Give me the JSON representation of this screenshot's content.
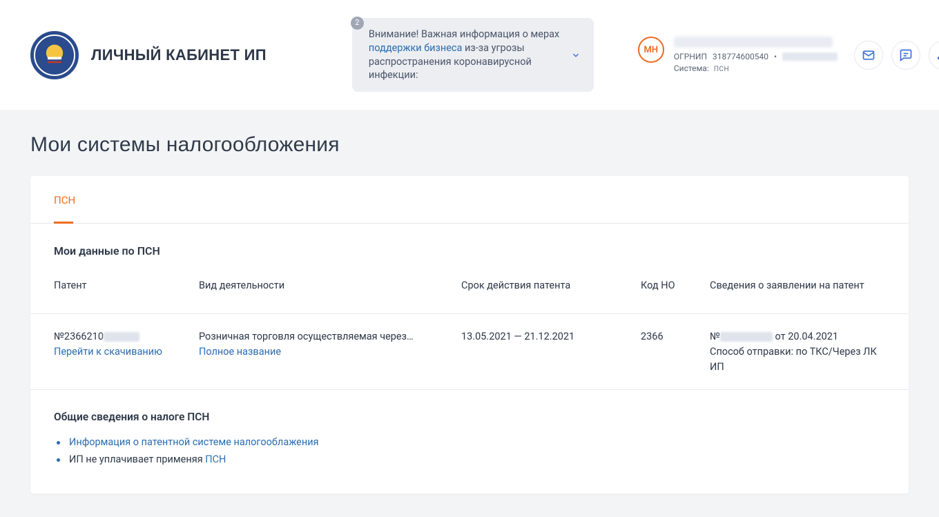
{
  "header": {
    "site_title": "ЛИЧНЫЙ КАБИНЕТ ИП",
    "notice": {
      "badge": "2",
      "text_before": "Внимание! Важная информация о мерах ",
      "link": "поддержки бизнеса",
      "text_after": " из-за угрозы распространения коронавирусной инфекции:"
    },
    "profile": {
      "initials": "МН",
      "ogrnip_label": "ОГРНИП",
      "ogrnip_value": "318774600540",
      "system_label": "Система:",
      "system_value": "ПСН"
    }
  },
  "page": {
    "title": "Мои системы налогообложения"
  },
  "tabs": {
    "psn": "ПСН"
  },
  "psn_data": {
    "title": "Мои данные по ПСН",
    "columns": {
      "patent": "Патент",
      "activity": "Вид деятельности",
      "validity": "Срок действия патента",
      "code": "Код НО",
      "application": "Сведения о заявлении на патент"
    },
    "row": {
      "patent_prefix": "№",
      "patent_id_visible": "2366210",
      "download": "Перейти к скачиванию",
      "activity": "Розничная торговля осуществляемая через…",
      "full_name_link": "Полное название",
      "validity": "13.05.2021 — 21.12.2021",
      "code": "2366",
      "appl_prefix": "№",
      "appl_suffix": " от 20.04.2021",
      "send_method": "Способ отправки: по ТКС/Через ЛК ИП"
    }
  },
  "general": {
    "title": "Общие сведения о налоге ПСН",
    "links": {
      "info": "Информация о патентной системе налогооблажения",
      "ip_text": "ИП не уплачивает применяя ",
      "ip_link": "ПСН"
    }
  }
}
